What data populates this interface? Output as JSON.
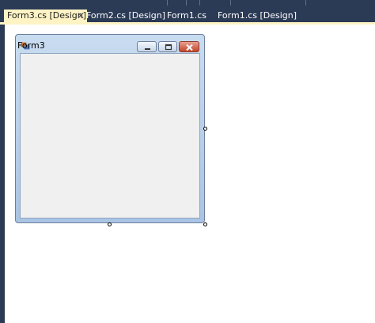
{
  "tabs": [
    {
      "label": "Form3.cs [Design]",
      "active": true,
      "closable": true
    },
    {
      "label": "Form2.cs [Design]",
      "active": false
    },
    {
      "label": "Form1.cs",
      "active": false
    },
    {
      "label": "Form1.cs [Design]",
      "active": false
    }
  ],
  "close_glyph": "✕",
  "form": {
    "title": "Form3",
    "icon": "windows-form-icon",
    "buttons": [
      "minimize-icon",
      "maximize-icon",
      "close-icon"
    ]
  },
  "colors": {
    "chrome": "#2b3a55",
    "active_tab": "#fdf3c4",
    "form_client": "#f0f0f0",
    "close_button": "#c2442b"
  }
}
